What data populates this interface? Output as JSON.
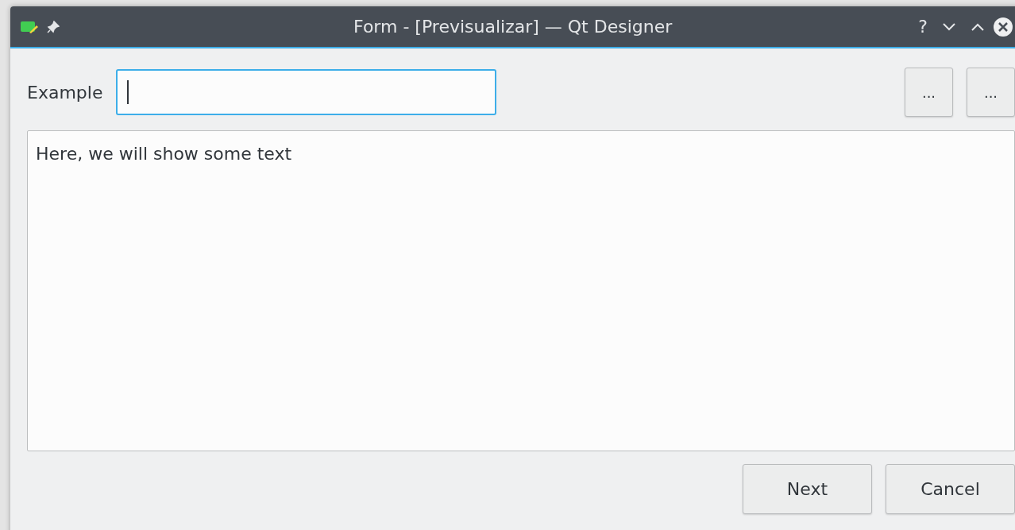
{
  "window": {
    "title": "Form - [Previsualizar] — Qt Designer",
    "help": "?"
  },
  "form": {
    "label": "Example",
    "field": {
      "focused": true
    },
    "tool_buttons": [
      "...",
      "..."
    ]
  },
  "text_area": {
    "text": "Here, we will show some text"
  },
  "buttons": [
    "Next",
    "Cancel"
  ]
}
